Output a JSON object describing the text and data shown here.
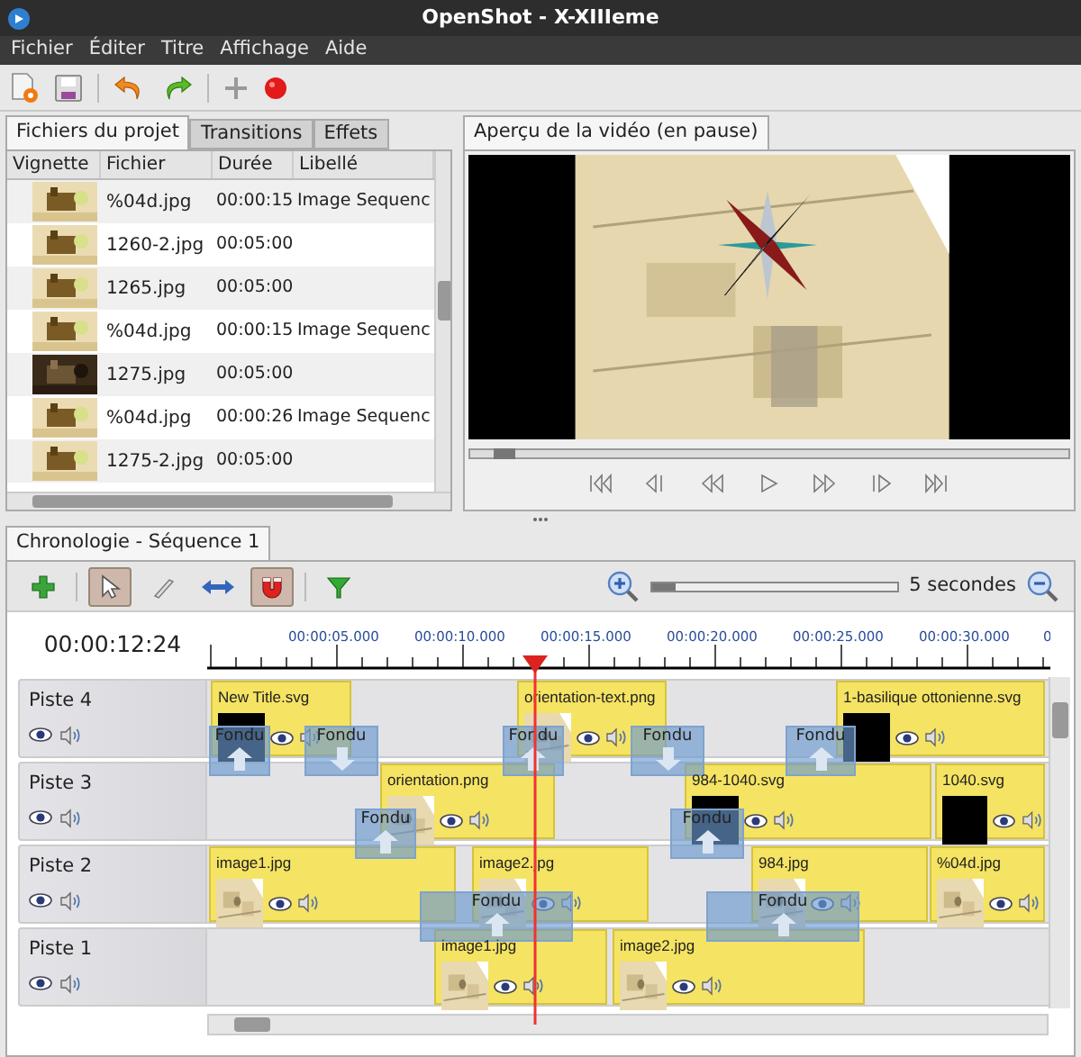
{
  "window": {
    "title": "OpenShot - X-XIIIeme"
  },
  "menu": [
    "Fichier",
    "Éditer",
    "Titre",
    "Affichage",
    "Aide"
  ],
  "project_tabs": [
    {
      "label": "Fichiers du projet",
      "selected": true
    },
    {
      "label": "Transitions",
      "selected": false
    },
    {
      "label": "Effets",
      "selected": false
    }
  ],
  "files_table": {
    "columns": [
      "Vignette",
      "Fichier",
      "Durée",
      "Libellé"
    ],
    "rows": [
      {
        "file": "%04d.jpg",
        "duration": "00:00:15",
        "label": "Image Sequenc"
      },
      {
        "file": "1260-2.jpg",
        "duration": "00:05:00"
      },
      {
        "file": "1265.jpg",
        "duration": "00:05:00"
      },
      {
        "file": "%04d.jpg",
        "duration": "00:00:15",
        "label": "Image Sequenc"
      },
      {
        "file": "1275.jpg",
        "duration": "00:05:00"
      },
      {
        "file": "%04d.jpg",
        "duration": "00:00:26",
        "label": "Image Sequenc"
      },
      {
        "file": "1275-2.jpg",
        "duration": "00:05:00"
      }
    ]
  },
  "preview": {
    "tab": "Aperçu de la vidéo (en pause)",
    "seek": {
      "level": 0.04
    }
  },
  "timeline": {
    "tab": "Chronologie - Séquence 1",
    "tools": [
      {
        "kind": "add",
        "selected": false
      },
      {
        "kind": "select",
        "selected": true
      },
      {
        "kind": "razor",
        "selected": false
      },
      {
        "kind": "resize",
        "selected": false
      },
      {
        "kind": "snap",
        "selected": true
      },
      {
        "kind": "marker",
        "selected": false
      }
    ],
    "zoom": {
      "level": 0.1,
      "reading": "5 secondes"
    },
    "timecode": "00:00:12:24",
    "ruler": [
      "00:00:05.000",
      "00:00:10.000",
      "00:00:15.000",
      "00:00:20.000",
      "00:00:25.000",
      "00:00:30.000",
      "0"
    ],
    "tracks": [
      {
        "name": "Piste 4",
        "clips": [
          {
            "name": "New Title.svg",
            "kind": "title"
          },
          {
            "name": "orientation-text.png"
          },
          {
            "name": "1-basilique ottonienne.svg",
            "kind": "title"
          }
        ]
      },
      {
        "name": "Piste 3",
        "clips": [
          {
            "name": "orientation.png"
          },
          {
            "name": "984-1040.svg",
            "kind": "title"
          },
          {
            "name": "1040.svg",
            "kind": "title"
          }
        ]
      },
      {
        "name": "Piste 2",
        "clips": [
          {
            "name": "image1.jpg"
          },
          {
            "name": "image2.jpg"
          },
          {
            "name": "984.jpg"
          },
          {
            "name": "%04d.jpg"
          }
        ]
      },
      {
        "name": "Piste 1",
        "clips": [
          {
            "name": "image1.jpg"
          },
          {
            "name": "image2.jpg"
          }
        ]
      }
    ],
    "transitions": [
      {
        "label": "Fondu",
        "kind": "up"
      },
      {
        "label": "Fondu",
        "kind": "down"
      },
      {
        "label": "Fondu",
        "kind": "up"
      },
      {
        "label": "Fondu",
        "kind": "down"
      },
      {
        "label": "Fondu",
        "kind": "up"
      },
      {
        "label": "Fondu",
        "kind": "up"
      },
      {
        "label": "Fondu",
        "kind": "up"
      },
      {
        "label": "Fondu",
        "kind": "up"
      },
      {
        "label": "Fondu",
        "kind": "up"
      }
    ]
  }
}
